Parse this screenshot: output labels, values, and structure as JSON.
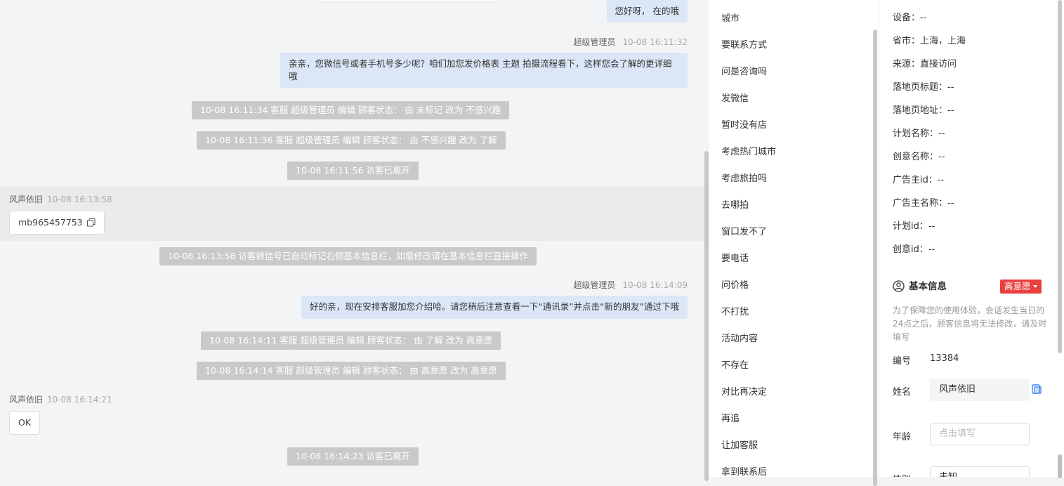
{
  "chat": {
    "messages": [
      {
        "kind": "out",
        "text": "您好呀， 在的哦"
      },
      {
        "kind": "out_meta",
        "sender": "超级管理员",
        "time": "10-08 16:11:32"
      },
      {
        "kind": "out",
        "text": "亲亲，您微信号或者手机号多少呢？咱们加您发价格表 主题 拍摄流程看下，这样您会了解的更详细哦"
      },
      {
        "kind": "system",
        "text": "10-08 16:11:34 客服 超级管理员 编辑 顾客状态： 由 未标记 改为 不感兴趣"
      },
      {
        "kind": "system",
        "text": "10-08 16:11:36 客服 超级管理员 编辑 顾客状态： 由 不感兴趣 改为 了解"
      },
      {
        "kind": "system",
        "text": "10-08 16:11:56 访客已离开"
      },
      {
        "kind": "in_meta",
        "sender": "风声依旧",
        "time": "10-08 16:13:58"
      },
      {
        "kind": "in",
        "text": "mb965457753"
      },
      {
        "kind": "system",
        "text": "10-08 16:13:58 访客微信号已自动标记右侧基本信息栏，如需修改请在基本信息栏直接操作"
      },
      {
        "kind": "out_meta",
        "sender": "超级管理员",
        "time": "10-08 16:14:09"
      },
      {
        "kind": "out",
        "text": "好的亲，现在安排客服加您介绍哈。请您稍后注意查看一下“通讯录”并点击“新的朋友”通过下哦"
      },
      {
        "kind": "system",
        "text": "10-08 16:14:11 客服 超级管理员 编辑 顾客状态： 由 了解 改为 高意愿"
      },
      {
        "kind": "system",
        "text": "10-08 16:14:14 客服 超级管理员 编辑 顾客状态： 由 高意愿 改为 高意愿"
      },
      {
        "kind": "in_meta",
        "sender": "风声依旧",
        "time": "10-08 16:14:21"
      },
      {
        "kind": "in",
        "text": "OK"
      },
      {
        "kind": "system",
        "text": "10-08 16:14:23 访客已离开"
      }
    ]
  },
  "quick_replies": [
    "城市",
    "要联系方式",
    "问是咨询吗",
    "发微信",
    "暂时没有店",
    "考虑热门城市",
    "考虑旅拍吗",
    "去哪拍",
    "窗口发不了",
    "要电话",
    "问价格",
    "不打扰",
    "活动内容",
    "不存在",
    "对比再决定",
    "再追",
    "让加客服",
    "拿到联系后"
  ],
  "visitor_info": {
    "lines": [
      "设备：--",
      "省市：上海，上海",
      "来源：直接访问",
      "落地页标题：--",
      "落地页地址：--",
      "计划名称：--",
      "创意名称：--",
      "广告主id：--",
      "广告主名称：--",
      "计划id：--",
      "创意id：--"
    ],
    "basic_section": {
      "title": "基本信息",
      "intent_label": "高意愿",
      "notice": "为了保障您的使用体验，会话发生当日的24点之后，顾客信息将无法修改，请及时填写",
      "id_label": "编号",
      "id_value": "13384",
      "name_label": "姓名",
      "name_value": "风声依旧",
      "age_label": "年龄",
      "age_placeholder": "点击填写",
      "gender_label": "性别",
      "gender_value": "未知"
    }
  },
  "colors": {
    "out_bubble": "#dbe6f7",
    "system_tag": "#c9c9c9",
    "intent_badge": "#e8413f",
    "copy_icon": "#3b82f6"
  }
}
